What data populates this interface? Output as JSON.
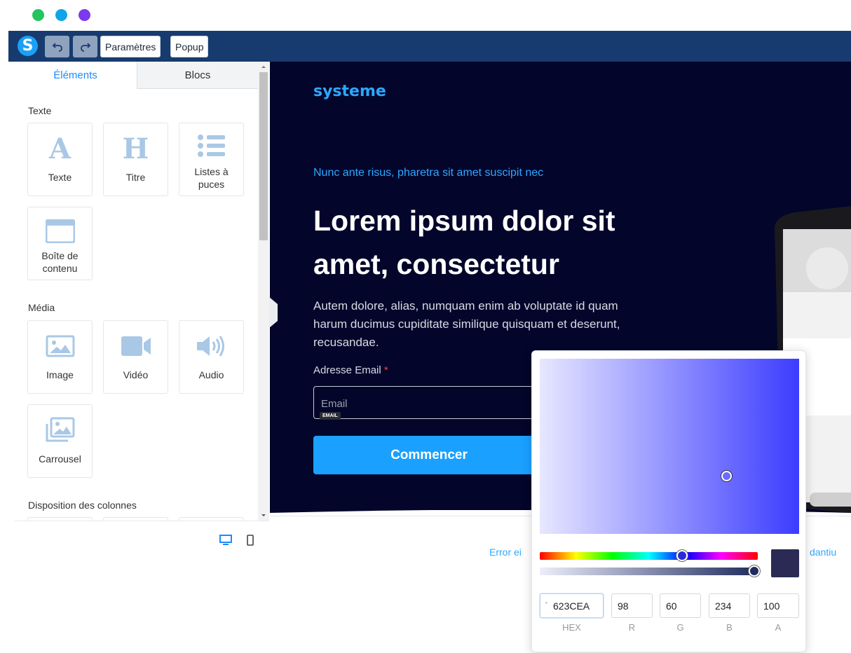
{
  "colors": {
    "dot_green": "#22c55e",
    "dot_blue": "#0ea5e9",
    "dot_purple": "#7c3aed",
    "topbar": "#173b6f",
    "accent": "#1aa0ff",
    "hero_bg": "#03062a"
  },
  "toolbar": {
    "logo": "S",
    "undo_icon": "undo-icon",
    "redo_icon": "redo-icon",
    "settings_label": "Paramètres",
    "popup_label": "Popup"
  },
  "sidebar": {
    "tabs": [
      "Éléments",
      "Blocs"
    ],
    "sections": {
      "text": "Texte",
      "media": "Média",
      "columns": "Disposition des colonnes"
    },
    "text_items": [
      {
        "label": "Texte",
        "glyph": "A",
        "icon": "text-icon"
      },
      {
        "label": "Titre",
        "glyph": "H",
        "icon": "heading-icon"
      },
      {
        "label": "Listes à puces",
        "icon": "bullet-list-icon"
      },
      {
        "label": "Boîte de contenu",
        "icon": "content-box-icon"
      }
    ],
    "media_items": [
      {
        "label": "Image",
        "icon": "image-icon"
      },
      {
        "label": "Vidéo",
        "icon": "video-icon"
      },
      {
        "label": "Audio",
        "icon": "audio-icon"
      },
      {
        "label": "Carrousel",
        "icon": "carousel-icon"
      }
    ],
    "footer_icons": [
      "desktop-icon",
      "mobile-icon"
    ]
  },
  "page": {
    "brand": "systeme",
    "kicker": "Nunc ante risus, pharetra sit amet suscipit nec",
    "headline": "Lorem ipsum dolor sit amet, consectetur",
    "paragraph": "Autem dolore, alias, numquam enim ab voluptate id quam harum ducimus cupiditate similique quisquam et deserunt, recusandae.",
    "email_label": "Adresse Email",
    "required_mark": "*",
    "email_placeholder": "Email",
    "email_tag": "EMAIL",
    "cta_label": "Commencer",
    "footer_left_partial": "Error ei",
    "footer_right_partial": "dantiu"
  },
  "color_picker": {
    "hex": "623CEA",
    "r": "98",
    "g": "60",
    "b": "234",
    "a": "100",
    "labels": [
      "HEX",
      "R",
      "G",
      "B",
      "A"
    ],
    "hue_position": 0.63,
    "alpha_position": 1.0,
    "swatch_color": "#2a2a55"
  }
}
